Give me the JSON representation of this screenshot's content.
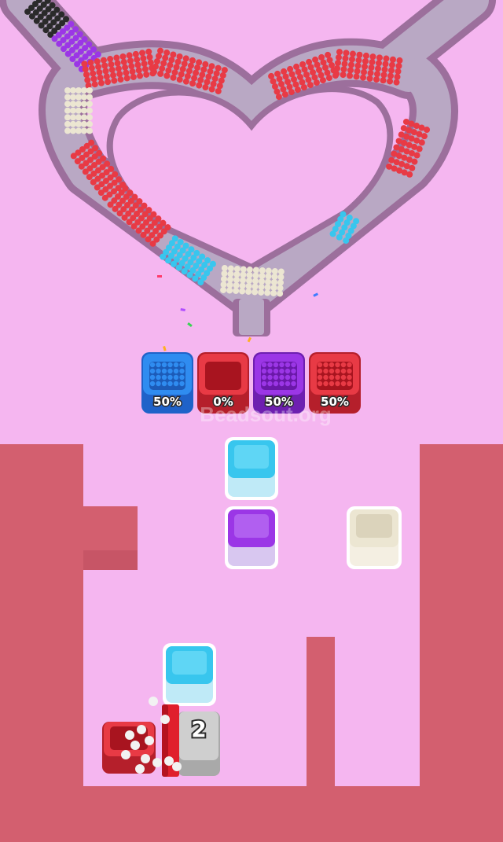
{
  "colors": {
    "background": "#f5b6f0",
    "wall": "#d35f6f",
    "track_stroke": "#9c6f9c",
    "track_fill": "#b9a8c4",
    "red": "#e83a45",
    "blue": "#2f8cf0",
    "cyan": "#38c6ee",
    "purple": "#9b36e6",
    "cream": "#ece6d2",
    "grey": "#c9c9c9"
  },
  "collectors": [
    {
      "color": "blue",
      "fill_label": "50%"
    },
    {
      "color": "red",
      "fill_label": "0%"
    },
    {
      "color": "purple",
      "fill_label": "50%"
    },
    {
      "color": "red",
      "fill_label": "50%"
    }
  ],
  "board_boxes": [
    {
      "name": "cyan-box-top",
      "color": "cyan"
    },
    {
      "name": "purple-box",
      "color": "purple"
    },
    {
      "name": "cream-box",
      "color": "cream"
    },
    {
      "name": "cyan-box-bottom",
      "color": "cyan"
    },
    {
      "name": "red-box-open",
      "color": "red"
    },
    {
      "name": "grey-counter-box",
      "color": "grey"
    }
  ],
  "counter_label": "2",
  "watermark": "Beadsout.org"
}
